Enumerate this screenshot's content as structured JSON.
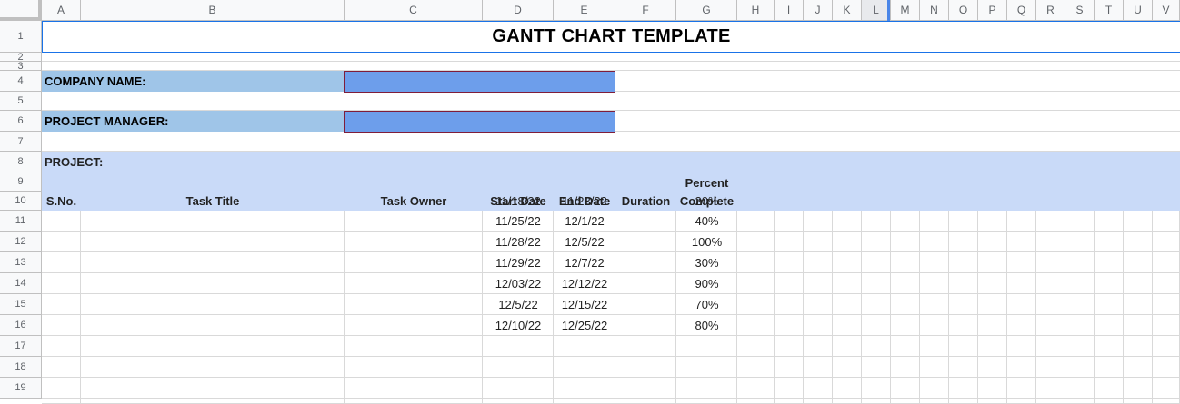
{
  "columns": [
    "A",
    "B",
    "C",
    "D",
    "E",
    "F",
    "G",
    "H",
    "I",
    "J",
    "K",
    "L",
    "M",
    "N",
    "O",
    "P",
    "Q",
    "R",
    "S",
    "T",
    "U",
    "V"
  ],
  "rows": [
    "1",
    "2",
    "3",
    "4",
    "5",
    "6",
    "7",
    "8",
    "9",
    "10",
    "11",
    "12",
    "13",
    "14",
    "15",
    "16",
    "17",
    "18",
    "19"
  ],
  "title": "GANTT CHART TEMPLATE",
  "company_label": "COMPANY NAME:",
  "company_value": "",
  "manager_label": "PROJECT MANAGER:",
  "manager_value": "",
  "project_label": "PROJECT:",
  "table_headers": {
    "sno": "S.No.",
    "task_title": "Task Title",
    "task_owner": "Task Owner",
    "start_date": "Start Date",
    "end_date": "End Date",
    "duration": "Duration",
    "percent_line1": "Percent",
    "percent_line2": "Complete"
  },
  "tasks": [
    {
      "start": "11/18/22",
      "end": "11/23/22",
      "percent": "20%"
    },
    {
      "start": "11/25/22",
      "end": "12/1/22",
      "percent": "40%"
    },
    {
      "start": "11/28/22",
      "end": "12/5/22",
      "percent": "100%"
    },
    {
      "start": "11/29/22",
      "end": "12/7/22",
      "percent": "30%"
    },
    {
      "start": "12/03/22",
      "end": "12/12/22",
      "percent": "90%"
    },
    {
      "start": "12/5/22",
      "end": "12/15/22",
      "percent": "70%"
    },
    {
      "start": "12/10/22",
      "end": "12/25/22",
      "percent": "80%"
    }
  ],
  "colors": {
    "label_bg": "#9fc5e8",
    "input_bg": "#6d9eeb",
    "header_bg": "#c9daf8",
    "selection": "#1a73e8"
  }
}
